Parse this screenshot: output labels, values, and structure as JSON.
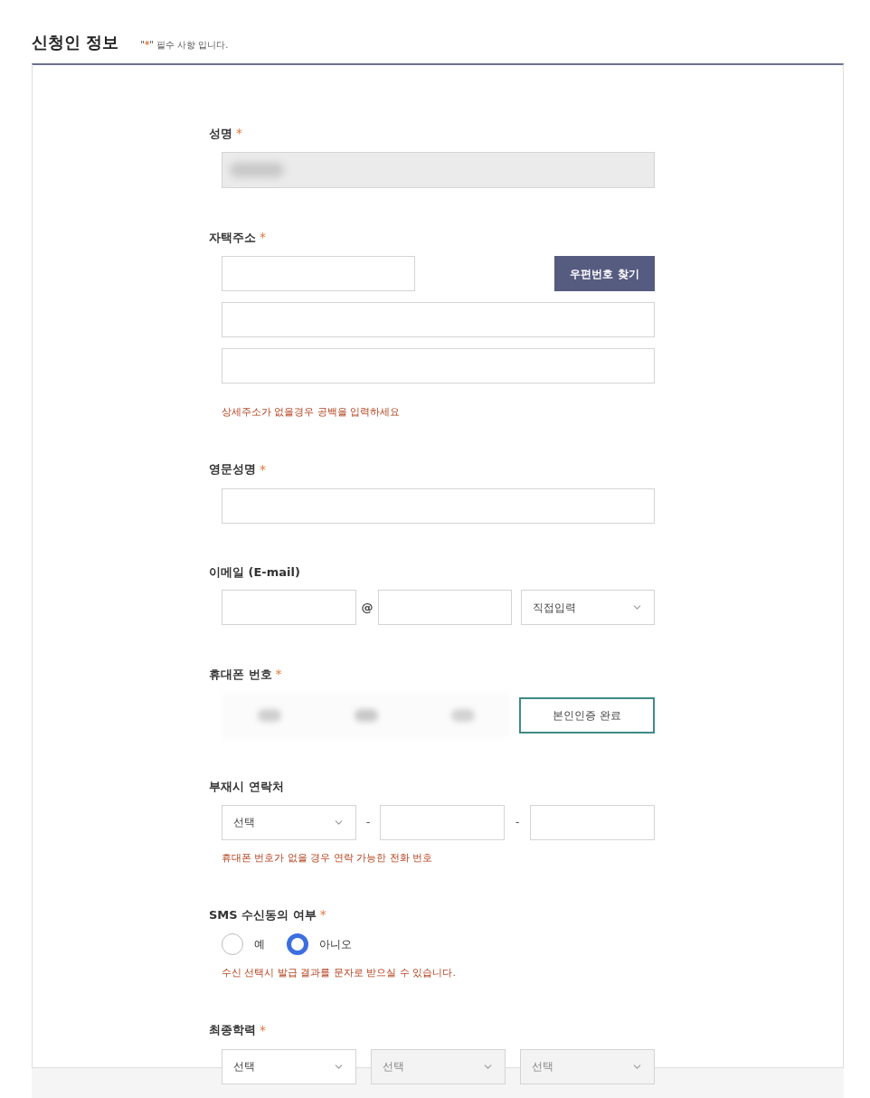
{
  "header": {
    "title": "신청인 정보",
    "note_open": "\"",
    "note_mark": "*",
    "note_text": "\" 필수 사항 입니다."
  },
  "fields": [
    {
      "kind": "name",
      "label": "성명",
      "required_mark": "*"
    },
    {
      "kind": "address",
      "label": "자택주소",
      "required_mark": "*",
      "button": "우편번호 찾기",
      "help": "상세주소가 없을경우 공백을 입력하세요"
    },
    {
      "kind": "text",
      "label": "영문성명",
      "required_mark": "*"
    },
    {
      "kind": "email",
      "label": "이메일 (E-mail)",
      "at": "@",
      "select": {
        "value": "직접입력",
        "disabled": false
      }
    },
    {
      "kind": "phone",
      "label": "휴대폰 번호",
      "required_mark": "*",
      "button": "본인인증 완료"
    },
    {
      "kind": "alt_phone",
      "label": "부재시 연락처",
      "select": {
        "value": "선택",
        "disabled": false
      },
      "dash_1": "-",
      "dash_2": "-",
      "help": "휴대폰 번호가 없을 경우 연락 가능한 전화 번호"
    },
    {
      "kind": "radio",
      "label": "SMS 수신동의 여부",
      "required_mark": "*",
      "options": [
        {
          "label": "예",
          "selected": false
        },
        {
          "label": "아니오",
          "selected": true
        }
      ],
      "help": "수신 선택시 발급 결과를 문자로 받으실 수 있습니다."
    },
    {
      "kind": "education",
      "label": "최종학력",
      "required_mark": "*",
      "selects": [
        {
          "value": "선택",
          "disabled": false
        },
        {
          "value": "선택",
          "disabled": true
        },
        {
          "value": "선택",
          "disabled": true
        }
      ]
    }
  ]
}
